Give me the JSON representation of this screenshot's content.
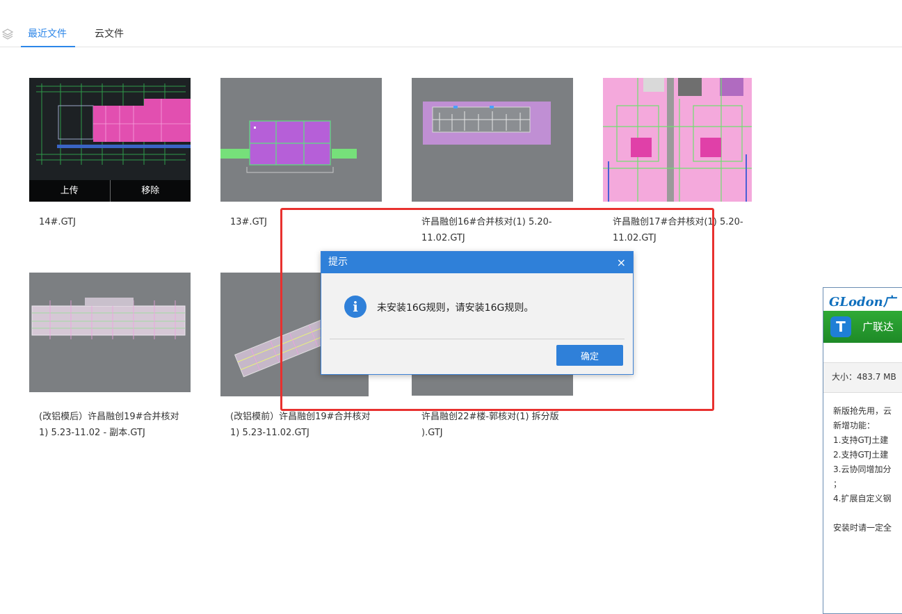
{
  "tabs": {
    "recent": "最近文件",
    "cloud": "云文件"
  },
  "files": [
    {
      "name": "14#.GTJ"
    },
    {
      "name": "13#.GTJ"
    },
    {
      "name": "许昌融创16#合并核对(1) 5.20-\n11.02.GTJ"
    },
    {
      "name": "许昌融创17#合并核对(1) 5.20-\n11.02.GTJ"
    },
    {
      "name": "(改铝模后）许昌融创19#合并核对\n1) 5.23-11.02 - 副本.GTJ"
    },
    {
      "name": "(改铝模前）许昌融创19#合并核对\n1) 5.23-11.02.GTJ"
    },
    {
      "name": "许昌融创22#楼-郭核对(1) 拆分版\n).GTJ"
    }
  ],
  "card_actions": {
    "upload": "上传",
    "remove": "移除"
  },
  "dialog": {
    "title": "提示",
    "close": "×",
    "message": "未安装16G规则，请安装16G规则。",
    "ok": "确定"
  },
  "promo": {
    "brand": "GLodon广",
    "app_name": "广联达",
    "size": "大小：483.7 MB",
    "lines": [
      "新版抢先用，云",
      "新增功能：",
      "1.支持GTJ土建",
      "2.支持GTJ土建",
      "3.云协同增加分",
      "；",
      "4.扩展自定义钢",
      "",
      "安装时请一定全"
    ]
  }
}
